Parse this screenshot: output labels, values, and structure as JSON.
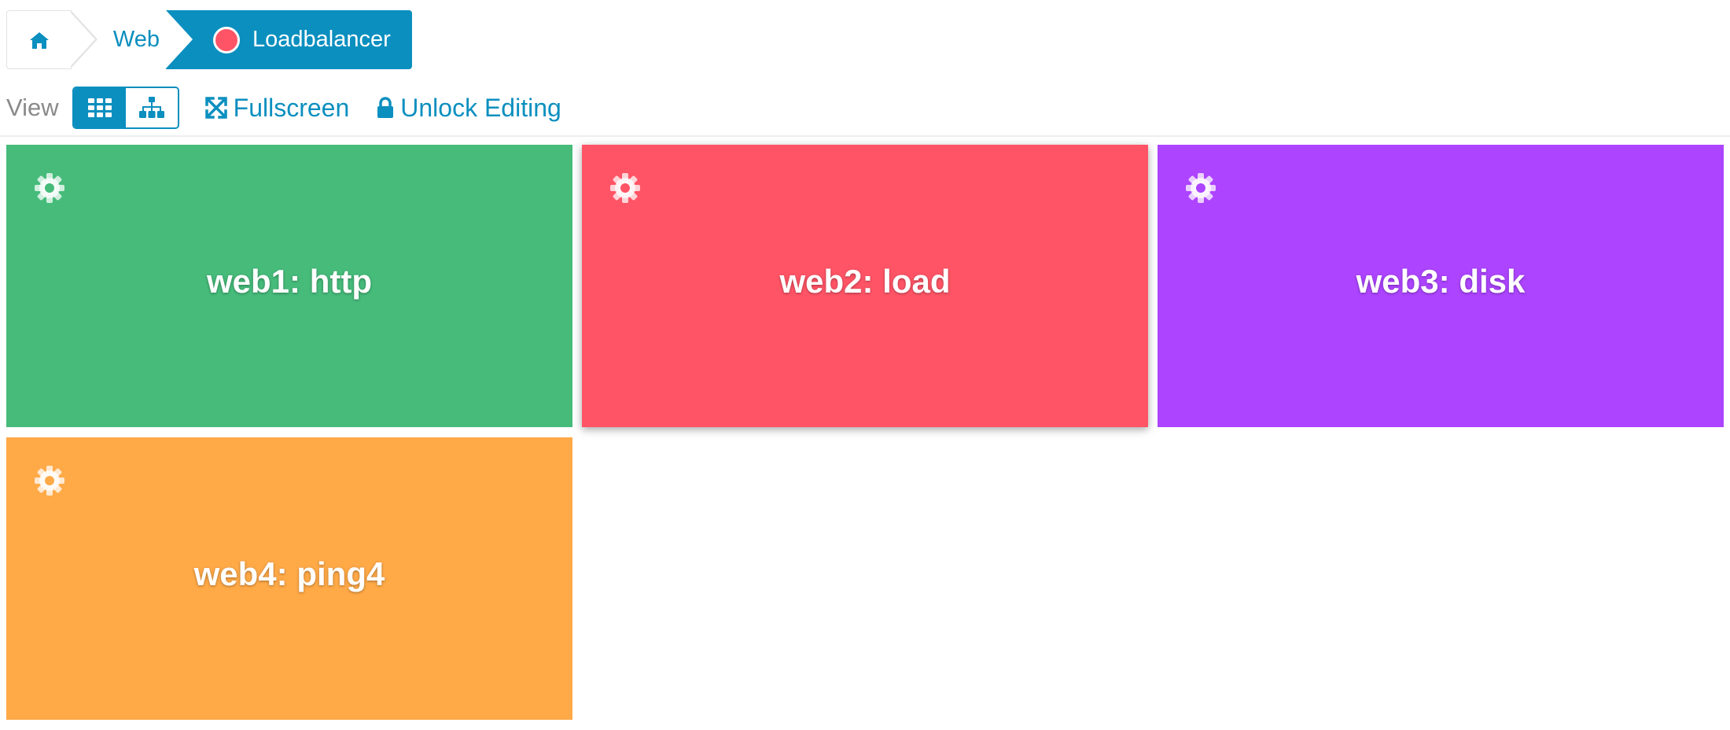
{
  "breadcrumb": {
    "home_icon": "home-icon",
    "parent_label": "Web",
    "current_label": "Loadbalancer",
    "current_status_color": "#ff5466",
    "accent_color": "#0b8fbf"
  },
  "toolbar": {
    "view_label": "View",
    "grid_view_icon": "grid-icon",
    "tree_view_icon": "sitemap-icon",
    "active_view": "grid",
    "fullscreen_icon": "expand-icon",
    "fullscreen_label": "Fullscreen",
    "lock_icon": "lock-icon",
    "unlock_label": "Unlock Editing"
  },
  "tiles": [
    {
      "label": "web1: http",
      "color": "#46bb7a",
      "icon": "gear-icon"
    },
    {
      "label": "web2: load",
      "color": "#ff5466",
      "icon": "gear-icon"
    },
    {
      "label": "web3: disk",
      "color": "#ad44ff",
      "icon": "gear-icon"
    },
    {
      "label": "web4: ping4",
      "color": "#ffa947",
      "icon": "gear-icon"
    }
  ]
}
